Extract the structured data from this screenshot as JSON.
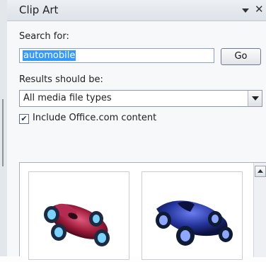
{
  "pane": {
    "title": "Clip Art"
  },
  "search": {
    "label": "Search for:",
    "value": "automobile",
    "go_label": "Go"
  },
  "results": {
    "label": "Results should be:",
    "media_type": "All media file types"
  },
  "include_office": {
    "label": "Include Office.com content",
    "checked": true
  },
  "icons": {
    "menu": "chevron-down-icon",
    "close": "close-icon",
    "check": "check-icon",
    "scroll_up": "chevron-up-icon"
  },
  "thumbnails": [
    {
      "subject": "red-vintage-race-car",
      "color": "#9c1a3a"
    },
    {
      "subject": "blue-vintage-roadster",
      "color": "#23339a"
    }
  ]
}
